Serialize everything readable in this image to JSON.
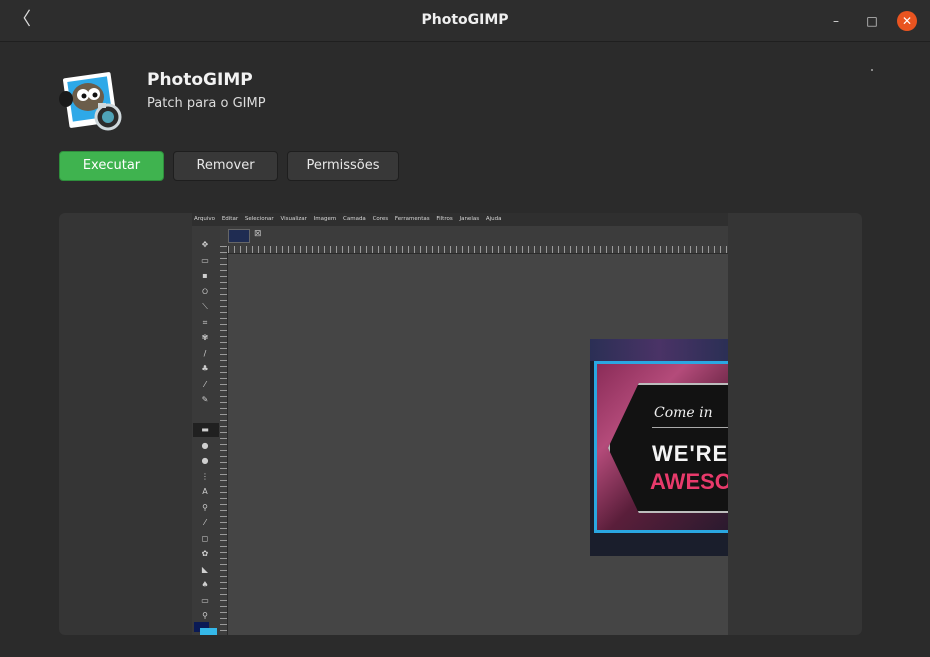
{
  "window": {
    "title": "PhotoGIMP",
    "back_glyph": "〈",
    "minimize_glyph": "–",
    "maximize_glyph": "□",
    "close_glyph": "✕",
    "close_color": "#e95420"
  },
  "app": {
    "name": "PhotoGIMP",
    "description": "Patch para o GIMP",
    "icon": "photogimp-logo-icon"
  },
  "actions": {
    "run_label": "Executar",
    "remove_label": "Remover",
    "permissions_label": "Permissões",
    "run_color": "#3fb34f"
  },
  "screenshot": {
    "menu": [
      "Arquivo",
      "Editar",
      "Selecionar",
      "Visualizar",
      "Imagem",
      "Camada",
      "Cores",
      "Ferramentas",
      "Filtros",
      "Janelas",
      "Ajuda"
    ],
    "tab_close_glyph": "⊠",
    "image_text_1": "Come in",
    "image_text_2": "WE'RE",
    "image_text_3": "AWESOME",
    "fg_color": "#0a1a55",
    "bg_color": "#35b8e9"
  }
}
